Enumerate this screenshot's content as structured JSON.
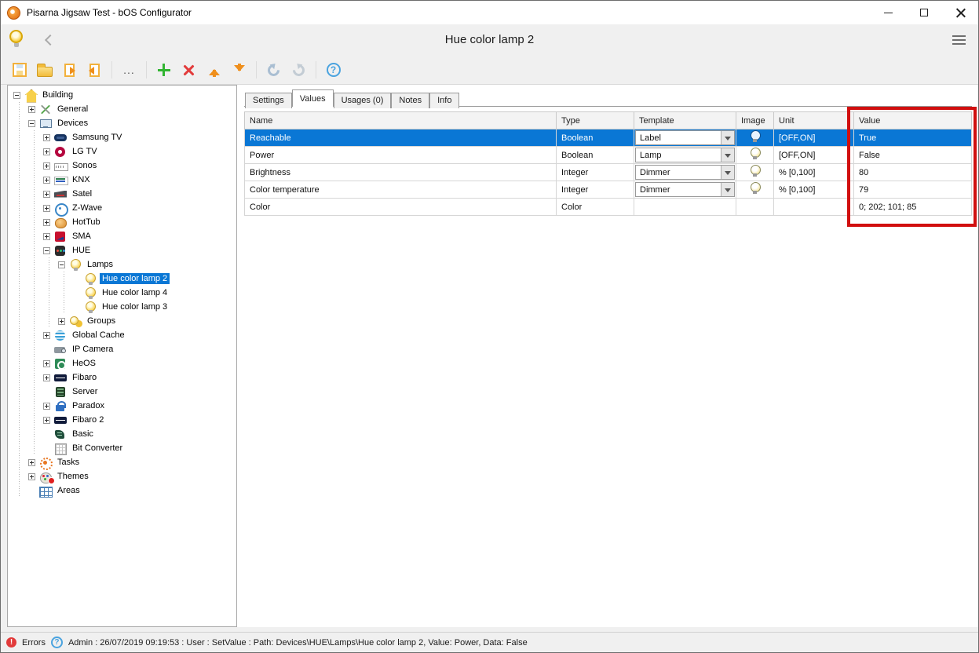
{
  "colors": {
    "selection_blue": "#0a77d5",
    "annotation_red": "#d10f0f",
    "toolbar_green": "#31b431",
    "toolbar_red": "#e23b3b",
    "toolbar_orange": "#ef8f1c",
    "accent_yellow": "#f2bc3b"
  },
  "titlebar": {
    "title": "Pisarna Jigsaw Test - bOS Configurator"
  },
  "header": {
    "title": "Hue color lamp 2"
  },
  "toolbar": {
    "more_label": "..."
  },
  "tabs": [
    {
      "label": "Settings",
      "active": false
    },
    {
      "label": "Values",
      "active": true
    },
    {
      "label": "Usages (0)",
      "active": false
    },
    {
      "label": "Notes",
      "active": false
    },
    {
      "label": "Info",
      "active": false
    }
  ],
  "tree": {
    "items": [
      {
        "label": "Building",
        "level": 0,
        "icon": "building",
        "expander": "minus",
        "selected": false
      },
      {
        "label": "General",
        "level": 1,
        "icon": "general",
        "expander": "plus",
        "selected": false
      },
      {
        "label": "Devices",
        "level": 1,
        "icon": "devices",
        "expander": "minus",
        "selected": false
      },
      {
        "label": "Samsung TV",
        "level": 2,
        "icon": "samsung",
        "expander": "plus",
        "selected": false
      },
      {
        "label": "LG TV",
        "level": 2,
        "icon": "lg",
        "expander": "plus",
        "selected": false
      },
      {
        "label": "Sonos",
        "level": 2,
        "icon": "sonos",
        "expander": "plus",
        "selected": false
      },
      {
        "label": "KNX",
        "level": 2,
        "icon": "knx",
        "expander": "plus",
        "selected": false
      },
      {
        "label": "Satel",
        "level": 2,
        "icon": "satel",
        "expander": "plus",
        "selected": false
      },
      {
        "label": "Z-Wave",
        "level": 2,
        "icon": "zwave",
        "expander": "plus",
        "selected": false
      },
      {
        "label": "HotTub",
        "level": 2,
        "icon": "hottub",
        "expander": "plus",
        "selected": false
      },
      {
        "label": "SMA",
        "level": 2,
        "icon": "sma",
        "expander": "plus",
        "selected": false
      },
      {
        "label": "HUE",
        "level": 2,
        "icon": "hue",
        "expander": "minus",
        "selected": false
      },
      {
        "label": "Lamps",
        "level": 3,
        "icon": "lamp",
        "expander": "minus",
        "selected": false
      },
      {
        "label": "Hue color lamp 2",
        "level": 4,
        "icon": "lamp",
        "expander": "none",
        "selected": true
      },
      {
        "label": "Hue color lamp 4",
        "level": 4,
        "icon": "lamp",
        "expander": "none",
        "selected": false
      },
      {
        "label": "Hue color lamp 3",
        "level": 4,
        "icon": "lamp",
        "expander": "none",
        "selected": false
      },
      {
        "label": "Groups",
        "level": 3,
        "icon": "groups",
        "expander": "plus",
        "selected": false
      },
      {
        "label": "Global Cache",
        "level": 2,
        "icon": "globalcache",
        "expander": "plus",
        "selected": false
      },
      {
        "label": "IP Camera",
        "level": 2,
        "icon": "ipcamera",
        "expander": "none",
        "selected": false
      },
      {
        "label": "HeOS",
        "level": 2,
        "icon": "heos",
        "expander": "plus",
        "selected": false
      },
      {
        "label": "Fibaro",
        "level": 2,
        "icon": "fibaro",
        "expander": "plus",
        "selected": false
      },
      {
        "label": "Server",
        "level": 2,
        "icon": "server",
        "expander": "none",
        "selected": false
      },
      {
        "label": "Paradox",
        "level": 2,
        "icon": "paradox",
        "expander": "plus",
        "selected": false
      },
      {
        "label": "Fibaro 2",
        "level": 2,
        "icon": "fibaro",
        "expander": "plus",
        "selected": false
      },
      {
        "label": "Basic",
        "level": 2,
        "icon": "basic",
        "expander": "none",
        "selected": false
      },
      {
        "label": "Bit Converter",
        "level": 2,
        "icon": "bitconverter",
        "expander": "none",
        "selected": false
      },
      {
        "label": "Tasks",
        "level": 1,
        "icon": "tasks",
        "expander": "plus",
        "selected": false
      },
      {
        "label": "Themes",
        "level": 1,
        "icon": "themes",
        "expander": "plus",
        "selected": false,
        "badge": true
      },
      {
        "label": "Areas",
        "level": 1,
        "icon": "areas",
        "expander": "none",
        "selected": false
      }
    ]
  },
  "table": {
    "columns": [
      "Name",
      "Type",
      "Template",
      "Image",
      "Unit",
      "Value"
    ],
    "rows": [
      {
        "name": "Reachable",
        "type": "Boolean",
        "template": "Label",
        "image": true,
        "unit": "[OFF,ON]",
        "value": "True",
        "selected": true
      },
      {
        "name": "Power",
        "type": "Boolean",
        "template": "Lamp",
        "image": true,
        "unit": "[OFF,ON]",
        "value": "False",
        "selected": false
      },
      {
        "name": "Brightness",
        "type": "Integer",
        "template": "Dimmer",
        "image": true,
        "unit": "% [0,100]",
        "value": "80",
        "selected": false
      },
      {
        "name": "Color temperature",
        "type": "Integer",
        "template": "Dimmer",
        "image": true,
        "unit": "% [0,100]",
        "value": "79",
        "selected": false
      },
      {
        "name": "Color",
        "type": "Color",
        "template": "",
        "image": false,
        "unit": "",
        "value": "0; 202; 101; 85",
        "selected": false
      }
    ]
  },
  "statusbar": {
    "errors_label": "Errors",
    "message": "Admin : 26/07/2019 09:19:53 : User : SetValue : Path: Devices\\HUE\\Lamps\\Hue color lamp 2, Value: Power, Data: False"
  }
}
